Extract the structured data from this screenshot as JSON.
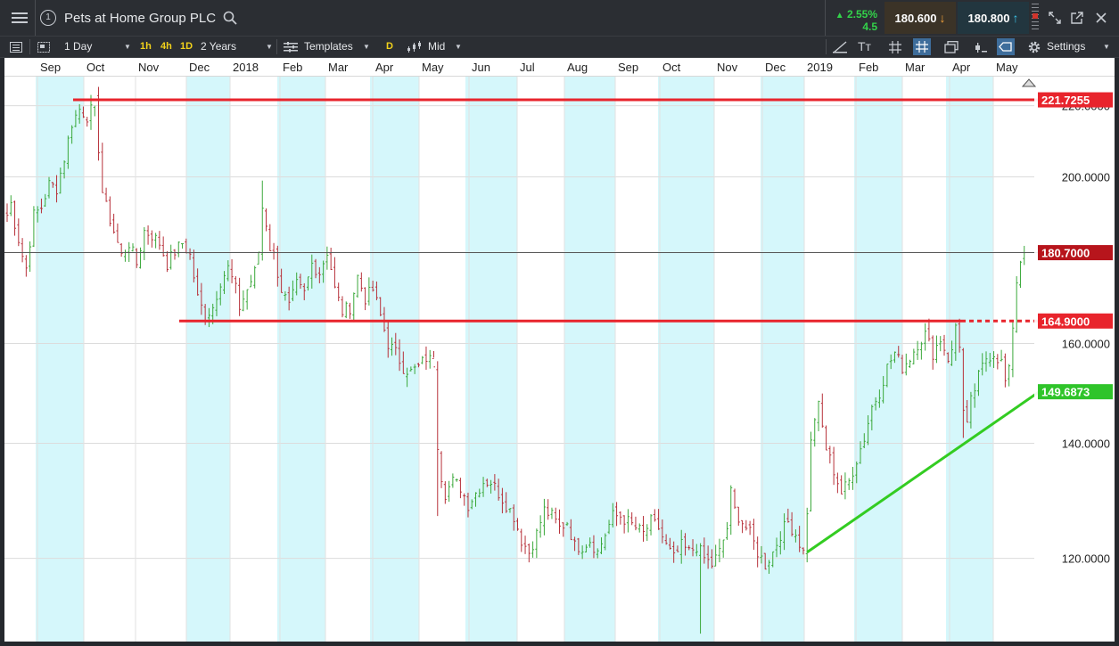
{
  "header": {
    "menu_icon": "hamburger-menu-icon",
    "slot_number": "1",
    "title": "Pets at Home Group PLC",
    "search_icon": "search-icon",
    "change_pct": "2.55%",
    "change_abs": "4.5",
    "sell_price": "180.600",
    "buy_price": "180.800",
    "sell_arrow": "↓",
    "buy_arrow": "↑",
    "right_icons": [
      "scroll-grip-icon",
      "expand-icon",
      "popout-icon",
      "close-icon"
    ]
  },
  "toolbar": {
    "interval": "1 Day",
    "quick_1h": "1h",
    "quick_4h": "4h",
    "quick_1d": "1D",
    "range": "2 Years",
    "templates": "Templates",
    "d_badge": "D",
    "price_type": "Mid",
    "settings": "Settings"
  },
  "colors": {
    "band": "#d5f7fb",
    "bull": "#3aa83a",
    "bear": "#b7313a",
    "red_line": "#e8242c",
    "green_line": "#33cc22",
    "last_price_bg": "#b7151c"
  },
  "chart_data": {
    "type": "candlestick",
    "time_labels": [
      "Sep",
      "Oct",
      "Nov",
      "Dec",
      "2018",
      "Feb",
      "Mar",
      "Apr",
      "May",
      "Jun",
      "Jul",
      "Aug",
      "Sep",
      "Oct",
      "Nov",
      "Dec",
      "2019",
      "Feb",
      "Mar",
      "Apr",
      "May"
    ],
    "y_ticks": [
      120,
      140,
      160,
      200,
      220
    ],
    "y_tick_labels": [
      "120.0000",
      "140.0000",
      "160.0000",
      "200.0000",
      "220.0000"
    ],
    "y_log": true,
    "ylim": [
      108,
      229
    ],
    "grid": true,
    "path": [
      [
        0,
        190
      ],
      [
        1,
        193
      ],
      [
        2,
        188
      ],
      [
        4,
        180
      ],
      [
        5,
        177
      ],
      [
        7,
        190
      ],
      [
        9,
        192
      ],
      [
        11,
        198
      ],
      [
        13,
        197
      ],
      [
        15,
        205
      ],
      [
        17,
        215
      ],
      [
        19,
        219
      ],
      [
        21,
        217
      ],
      [
        23,
        220
      ],
      [
        25,
        196
      ],
      [
        26,
        192
      ],
      [
        28,
        186
      ],
      [
        30,
        180
      ],
      [
        32,
        183
      ],
      [
        34,
        178
      ],
      [
        36,
        186
      ],
      [
        38,
        185
      ],
      [
        40,
        183
      ],
      [
        42,
        178
      ],
      [
        44,
        181
      ],
      [
        46,
        183
      ],
      [
        48,
        180
      ],
      [
        50,
        170
      ],
      [
        52,
        166
      ],
      [
        54,
        168
      ],
      [
        56,
        174
      ],
      [
        58,
        177
      ],
      [
        60,
        172
      ],
      [
        61,
        168
      ],
      [
        63,
        172
      ],
      [
        65,
        176
      ],
      [
        66,
        181
      ],
      [
        67,
        192
      ],
      [
        68,
        188
      ],
      [
        69,
        182
      ],
      [
        70,
        180
      ],
      [
        72,
        172
      ],
      [
        74,
        168
      ],
      [
        76,
        173
      ],
      [
        78,
        171
      ],
      [
        80,
        178
      ],
      [
        82,
        176
      ],
      [
        84,
        181
      ],
      [
        85,
        177
      ],
      [
        86,
        172
      ],
      [
        88,
        167
      ],
      [
        90,
        168
      ],
      [
        92,
        175
      ],
      [
        94,
        170
      ],
      [
        96,
        172
      ],
      [
        98,
        166
      ],
      [
        100,
        160
      ],
      [
        102,
        158
      ],
      [
        104,
        155
      ],
      [
        106,
        154
      ],
      [
        108,
        155
      ],
      [
        110,
        157
      ],
      [
        112,
        156
      ],
      [
        113,
        140
      ],
      [
        114,
        134
      ],
      [
        115,
        131
      ],
      [
        117,
        133
      ],
      [
        119,
        132
      ],
      [
        121,
        129
      ],
      [
        123,
        131
      ],
      [
        125,
        133
      ],
      [
        127,
        133
      ],
      [
        129,
        131
      ],
      [
        131,
        129
      ],
      [
        133,
        127
      ],
      [
        135,
        123
      ],
      [
        137,
        121
      ],
      [
        139,
        124
      ],
      [
        141,
        128
      ],
      [
        143,
        127
      ],
      [
        145,
        125
      ],
      [
        147,
        126
      ],
      [
        149,
        122
      ],
      [
        151,
        122
      ],
      [
        153,
        123
      ],
      [
        155,
        121
      ],
      [
        157,
        124
      ],
      [
        159,
        127
      ],
      [
        161,
        127
      ],
      [
        163,
        126
      ],
      [
        165,
        125
      ],
      [
        167,
        124
      ],
      [
        169,
        126
      ],
      [
        171,
        125
      ],
      [
        173,
        122
      ],
      [
        174,
        121
      ],
      [
        175,
        120
      ],
      [
        177,
        122
      ],
      [
        179,
        121
      ],
      [
        181,
        122
      ],
      [
        183,
        120
      ],
      [
        185,
        119
      ],
      [
        187,
        121
      ],
      [
        189,
        125
      ],
      [
        190,
        131
      ],
      [
        191,
        128
      ],
      [
        193,
        126
      ],
      [
        195,
        124
      ],
      [
        197,
        121
      ],
      [
        199,
        119
      ],
      [
        201,
        121
      ],
      [
        203,
        124
      ],
      [
        205,
        126
      ],
      [
        207,
        124
      ],
      [
        209,
        121
      ],
      [
        210,
        128
      ],
      [
        211,
        140
      ],
      [
        212,
        145
      ],
      [
        213,
        147
      ],
      [
        214,
        143
      ],
      [
        215,
        139
      ],
      [
        216,
        137
      ],
      [
        218,
        133
      ],
      [
        219,
        131
      ],
      [
        221,
        133
      ],
      [
        223,
        137
      ],
      [
        225,
        141
      ],
      [
        227,
        147
      ],
      [
        229,
        150
      ],
      [
        231,
        155
      ],
      [
        233,
        158
      ],
      [
        235,
        155
      ],
      [
        237,
        157
      ],
      [
        239,
        160
      ],
      [
        241,
        162
      ],
      [
        243,
        158
      ],
      [
        245,
        161
      ],
      [
        247,
        157
      ],
      [
        248,
        158
      ],
      [
        249,
        164
      ],
      [
        250,
        160
      ],
      [
        251,
        146
      ],
      [
        252,
        143
      ],
      [
        253,
        148
      ],
      [
        255,
        153
      ],
      [
        257,
        157
      ],
      [
        259,
        158
      ],
      [
        261,
        156
      ],
      [
        262,
        152
      ],
      [
        263,
        154
      ],
      [
        264,
        164
      ],
      [
        265,
        174
      ],
      [
        266,
        179
      ],
      [
        267,
        180.7
      ]
    ],
    "lows": [
      [
        182,
        108.5
      ],
      [
        113,
        127
      ],
      [
        112,
        157
      ],
      [
        251,
        141
      ]
    ],
    "highs": [
      [
        67,
        199
      ],
      [
        23,
        220
      ]
    ],
    "levels": [
      {
        "value": 221.7255,
        "label": "221.7255"
      },
      {
        "value": 164.9,
        "label": "164.9000"
      },
      {
        "value": 180.7,
        "label": "180.7000"
      }
    ],
    "trend": {
      "from": [
        210,
        121
      ],
      "to": [
        270,
        150
      ],
      "label": "149.6873"
    }
  }
}
